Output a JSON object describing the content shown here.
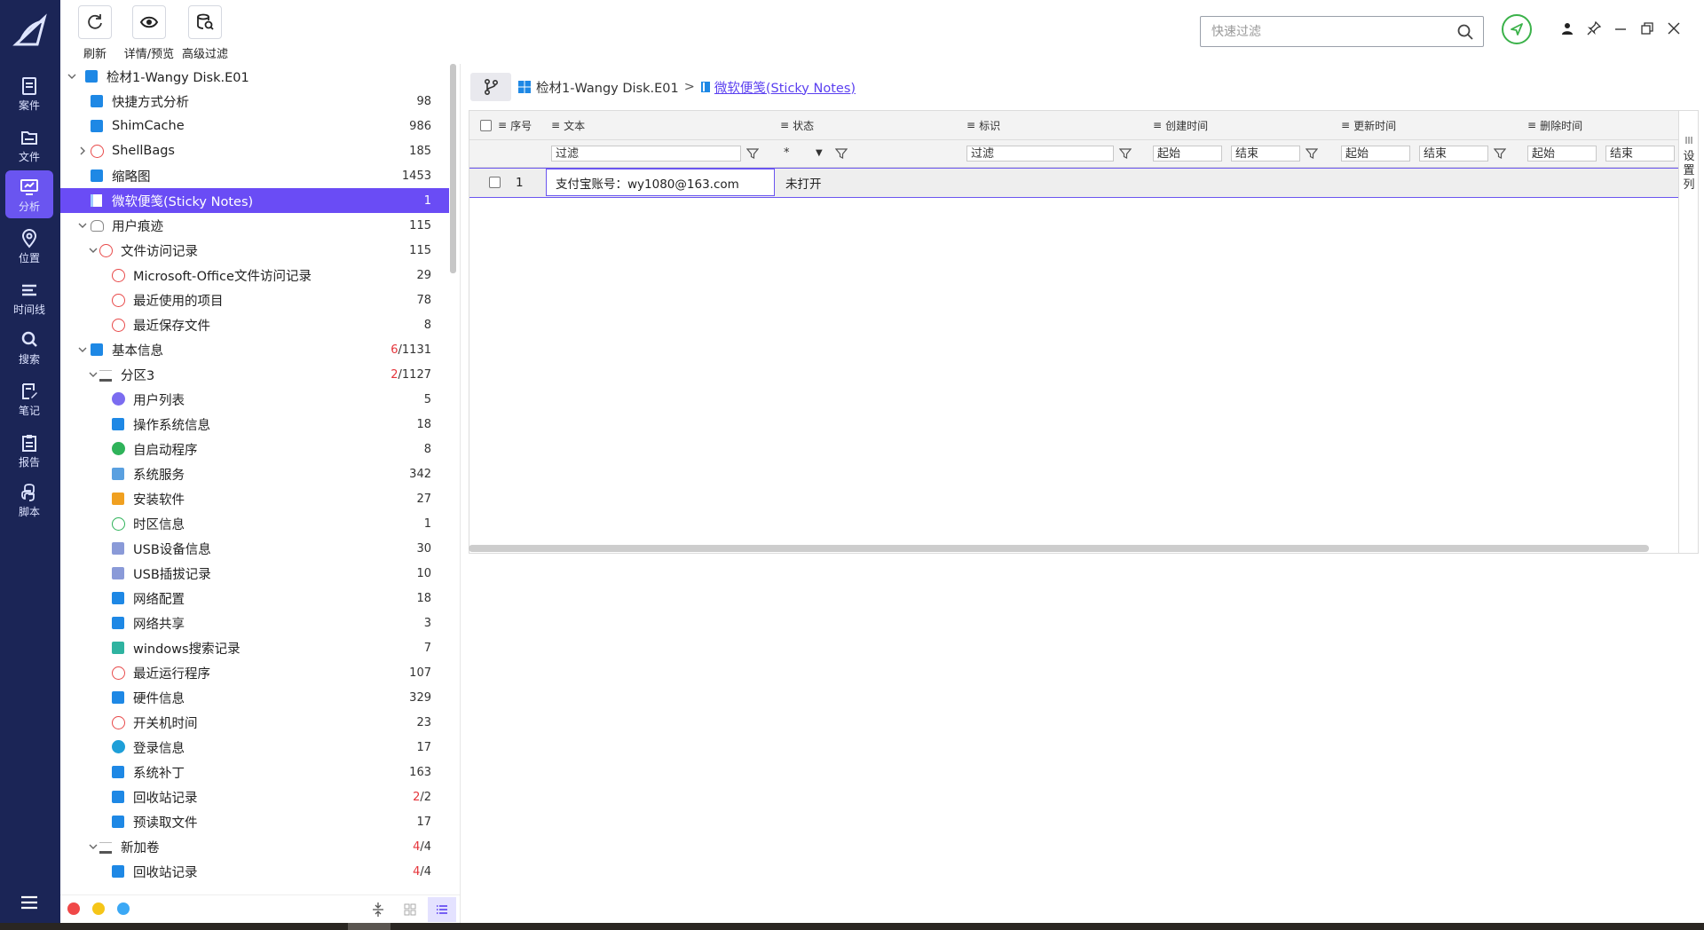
{
  "toolbar": {
    "refresh_label": "刷新",
    "detail_label": "详情/预览",
    "advanced_filter_label": "高级过滤"
  },
  "quick_filter": {
    "placeholder": "快速过滤",
    "value": ""
  },
  "nav": {
    "items": [
      {
        "label": "案件",
        "icon": "case-icon"
      },
      {
        "label": "文件",
        "icon": "folder-icon"
      },
      {
        "label": "分析",
        "icon": "analysis-icon",
        "active": true
      },
      {
        "label": "位置",
        "icon": "location-pin-icon"
      },
      {
        "label": "时间线",
        "icon": "timeline-icon"
      },
      {
        "label": "搜索",
        "icon": "search-icon"
      },
      {
        "label": "笔记",
        "icon": "note-icon"
      },
      {
        "label": "报告",
        "icon": "report-icon"
      },
      {
        "label": "脚本",
        "icon": "python-icon"
      }
    ]
  },
  "tree": {
    "items": [
      {
        "label": "检材1-Wangy Disk.E01",
        "count": "",
        "level": 0,
        "expanded": true,
        "icon": "windows-icon"
      },
      {
        "label": "快捷方式分析",
        "count": "98",
        "level": 1,
        "icon": "shortcut-icon"
      },
      {
        "label": "ShimCache",
        "count": "986",
        "level": 1,
        "icon": "database-icon"
      },
      {
        "label": "ShellBags",
        "count": "185",
        "level": 1,
        "collapsed": true,
        "icon": "clock-icon"
      },
      {
        "label": "缩略图",
        "count": "1453",
        "level": 1,
        "icon": "image-icon"
      },
      {
        "label": "微软便笺(Sticky Notes)",
        "count": "1",
        "level": 1,
        "selected": true,
        "icon": "sticky-note-icon"
      },
      {
        "label": "用户痕迹",
        "count": "115",
        "level": 1,
        "expanded": true,
        "icon": "footprint-icon"
      },
      {
        "label": "文件访问记录",
        "count": "115",
        "level": 2,
        "expanded": true,
        "icon": "clock-icon"
      },
      {
        "label": "Microsoft-Office文件访问记录",
        "count": "29",
        "level": 3,
        "icon": "clock-icon"
      },
      {
        "label": "最近使用的项目",
        "count": "78",
        "level": 3,
        "icon": "clock-icon"
      },
      {
        "label": "最近保存文件",
        "count": "8",
        "level": 3,
        "icon": "clock-icon"
      },
      {
        "label": "基本信息",
        "count_red": "6",
        "count_rest": "/1131",
        "level": 1,
        "expanded": true,
        "icon": "info-list-icon"
      },
      {
        "label": "分区3",
        "count_red": "2",
        "count_rest": "/1127",
        "level": 2,
        "expanded": true,
        "icon": "drive-icon"
      },
      {
        "label": "用户列表",
        "count": "5",
        "level": 3,
        "icon": "user-icon"
      },
      {
        "label": "操作系统信息",
        "count": "18",
        "level": 3,
        "icon": "os-info-icon"
      },
      {
        "label": "自启动程序",
        "count": "8",
        "level": 3,
        "icon": "play-icon"
      },
      {
        "label": "系统服务",
        "count": "342",
        "level": 3,
        "icon": "services-icon"
      },
      {
        "label": "安装软件",
        "count": "27",
        "level": 3,
        "icon": "package-icon"
      },
      {
        "label": "时区信息",
        "count": "1",
        "level": 3,
        "icon": "timezone-icon"
      },
      {
        "label": "USB设备信息",
        "count": "30",
        "level": 3,
        "icon": "usb-icon"
      },
      {
        "label": "USB插拔记录",
        "count": "10",
        "level": 3,
        "icon": "usb-icon"
      },
      {
        "label": "网络配置",
        "count": "18",
        "level": 3,
        "icon": "network-config-icon"
      },
      {
        "label": "网络共享",
        "count": "3",
        "level": 3,
        "icon": "network-share-icon"
      },
      {
        "label": "windows搜索记录",
        "count": "7",
        "level": 3,
        "icon": "search-record-icon"
      },
      {
        "label": "最近运行程序",
        "count": "107",
        "level": 3,
        "icon": "clock-icon"
      },
      {
        "label": "硬件信息",
        "count": "329",
        "level": 3,
        "icon": "chip-icon"
      },
      {
        "label": "开关机时间",
        "count": "23",
        "level": 3,
        "icon": "power-icon"
      },
      {
        "label": "登录信息",
        "count": "17",
        "level": 3,
        "icon": "login-icon"
      },
      {
        "label": "系统补丁",
        "count": "163",
        "level": 3,
        "icon": "patch-icon"
      },
      {
        "label": "回收站记录",
        "count_red": "2",
        "count_rest": "/2",
        "level": 3,
        "icon": "recycle-icon"
      },
      {
        "label": "预读取文件",
        "count": "17",
        "level": 3,
        "icon": "prefetch-icon"
      },
      {
        "label": "新加卷",
        "count_red": "4",
        "count_rest": "/4",
        "level": 2,
        "expanded": true,
        "icon": "drive-icon"
      },
      {
        "label": "回收站记录",
        "count_red": "4",
        "count_rest": "/4",
        "level": 3,
        "icon": "recycle-icon"
      }
    ]
  },
  "breadcrumb": {
    "root": "检材1-Wangy Disk.E01",
    "separator": ">",
    "current": "微软便笺(Sticky Notes)"
  },
  "table": {
    "columns": [
      "序号",
      "文本",
      "状态",
      "标识",
      "创建时间",
      "更新时间",
      "删除时间"
    ],
    "filters": {
      "text": "过滤",
      "status": "*",
      "mark": "过滤",
      "created_start": "起始",
      "created_end": "结束",
      "updated_start": "起始",
      "updated_end": "结束",
      "deleted_start": "起始",
      "deleted_end": "结束"
    },
    "rows": [
      {
        "index": "1",
        "text": "支付宝账号：wy1080@163.com",
        "status": "未打开",
        "mark": "",
        "created": "",
        "updated": "",
        "deleted": ""
      }
    ]
  },
  "settings_column_label": "设置列",
  "colors": {
    "rail_bg": "#1b2556",
    "accent": "#6a4cf5",
    "send_button": "#3bb24a",
    "dot_red": "#f04848",
    "dot_yellow": "#f5c518",
    "dot_blue": "#3ba8f5",
    "count_red": "#e5353b"
  }
}
